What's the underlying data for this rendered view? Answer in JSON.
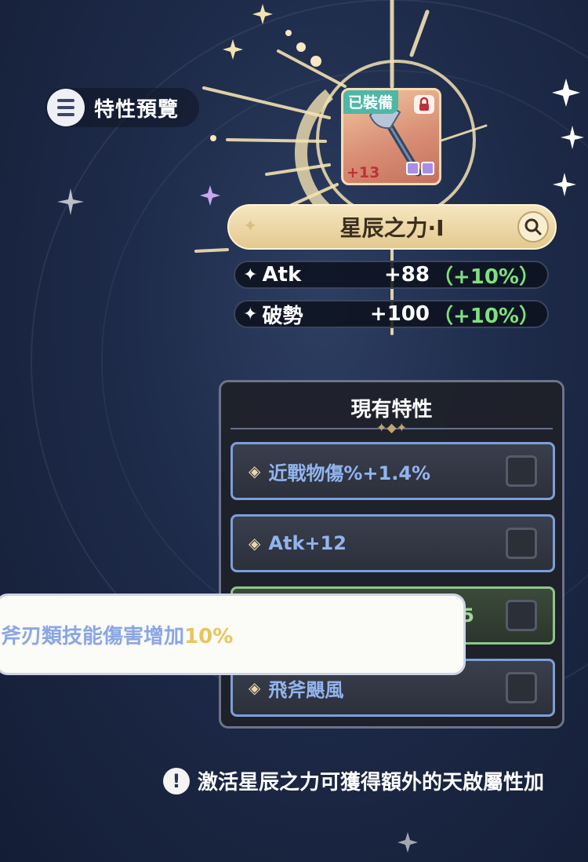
{
  "header": {
    "preview_label": "特性預覽"
  },
  "weapon": {
    "equipped_badge": "已裝備",
    "level": "+13",
    "gem_count": 2
  },
  "star_power": {
    "title": "星辰之力·I",
    "stats": [
      {
        "name": "Atk",
        "value": "+88",
        "pct": "（+10%）"
      },
      {
        "name": "破勢",
        "value": "+100",
        "pct": "（+10%）"
      }
    ]
  },
  "panel": {
    "title": "現有特性",
    "rows": [
      {
        "label": "近戰物傷%+1.4%",
        "color": "blue",
        "checked": false
      },
      {
        "label": "Atk+12",
        "color": "blue",
        "checked": false
      },
      {
        "label": "5",
        "color": "green",
        "checked": false
      },
      {
        "label": "飛斧颶風",
        "color": "blue",
        "checked": false
      }
    ]
  },
  "tooltip": {
    "text": "斧刃類技能傷害增加",
    "value": "10%"
  },
  "footer": {
    "warn_icon": "!",
    "text": "激活星辰之力可獲得額外的天啟屬性加"
  },
  "colors": {
    "accent_gold": "#e3c98f",
    "row_blue": "#7d9ed8",
    "row_green": "#8fc48c",
    "pct_green": "#7ee07e",
    "tooltip_highlight": "#e7c55c"
  }
}
